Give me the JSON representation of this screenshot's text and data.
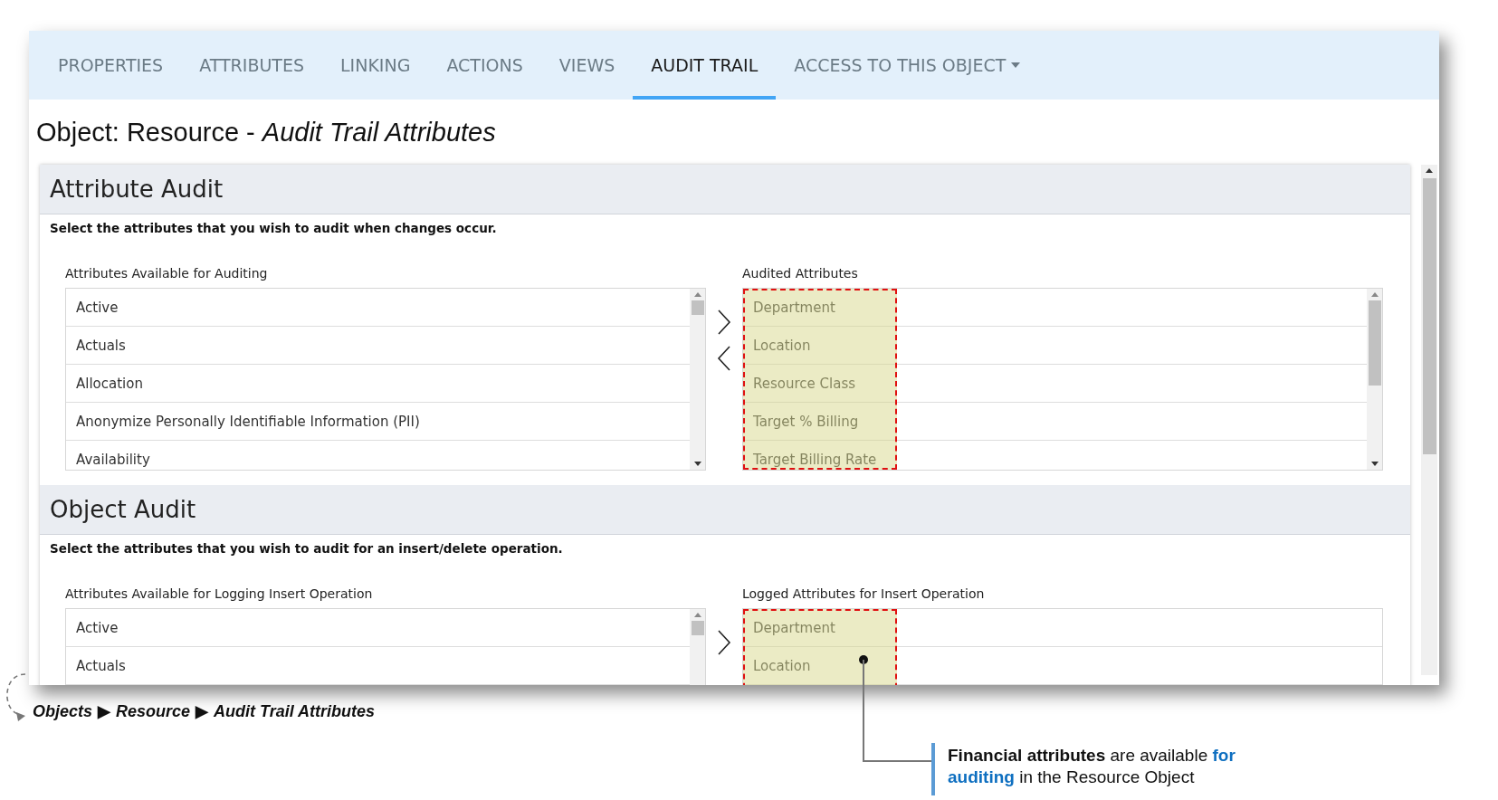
{
  "tabs": [
    {
      "label": "PROPERTIES",
      "selected": false,
      "dropdown": false
    },
    {
      "label": "ATTRIBUTES",
      "selected": false,
      "dropdown": false
    },
    {
      "label": "LINKING",
      "selected": false,
      "dropdown": false
    },
    {
      "label": "ACTIONS",
      "selected": false,
      "dropdown": false
    },
    {
      "label": "VIEWS",
      "selected": false,
      "dropdown": false
    },
    {
      "label": "AUDIT TRAIL",
      "selected": true,
      "dropdown": false
    },
    {
      "label": "ACCESS TO THIS OBJECT",
      "selected": false,
      "dropdown": true
    }
  ],
  "title": "Object: Resource - *Audit Trail Attributes*",
  "sections": [
    {
      "heading": "Attribute Audit",
      "instruction": "Select the attributes that you wish to audit when changes occur.",
      "available": {
        "label": "Attributes Available for Auditing",
        "scrollable": true,
        "highlighted": false,
        "items": [
          "Active",
          "Actuals",
          "Allocation",
          "Anonymize Personally Identifiable Information (PII)",
          "Availability"
        ]
      },
      "move_buttons": [
        {
          "kind": "add"
        },
        {
          "kind": "remove"
        }
      ],
      "chosen": {
        "label": "Audited Attributes",
        "scrollable": true,
        "highlighted": true,
        "items": [
          "Department",
          "Location",
          "Resource Class",
          "Target % Billing",
          "Target Billing Rate"
        ]
      }
    },
    {
      "heading": "Object Audit",
      "instruction": "Select the attributes that you wish to audit for an insert/delete operation.",
      "available": {
        "label": "Attributes Available for Logging Insert Operation",
        "scrollable": true,
        "highlighted": false,
        "items": [
          "Active",
          "Actuals"
        ]
      },
      "move_buttons": [
        {
          "kind": "add"
        }
      ],
      "chosen": {
        "label": "Logged Attributes for Insert Operation",
        "scrollable": false,
        "highlighted": true,
        "items": [
          "Department",
          "Location"
        ]
      }
    }
  ],
  "breadcrumb": {
    "items": [
      "Objects",
      "Resource",
      "Audit Trail Attributes"
    ],
    "separator": "▶"
  },
  "callout": [
    {
      "text": "Financial attributes",
      "kind": "bold"
    },
    {
      "text": " are available ",
      "kind": "plain"
    },
    {
      "text": "for auditing",
      "kind": "accent"
    },
    {
      "text": " in the Resource Object",
      "kind": "plain"
    }
  ]
}
